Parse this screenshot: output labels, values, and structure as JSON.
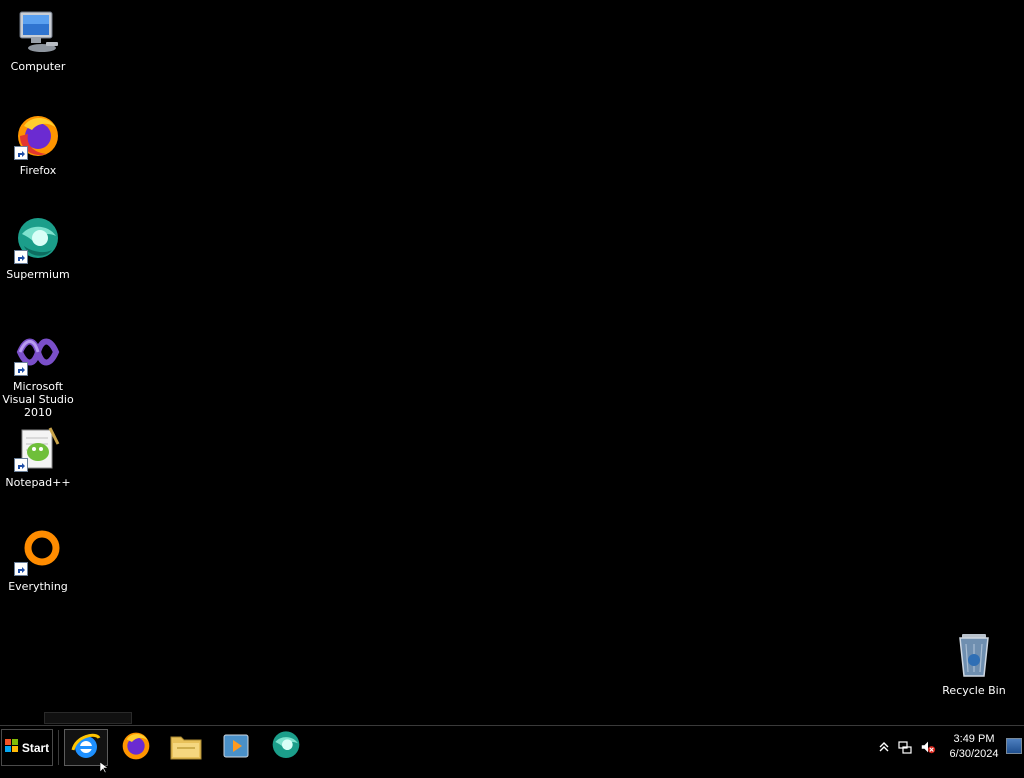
{
  "desktop": {
    "icons": [
      {
        "label": "Computer"
      },
      {
        "label": "Firefox"
      },
      {
        "label": "Supermium"
      },
      {
        "label": "Microsoft Visual Studio 2010"
      },
      {
        "label": "Notepad++"
      },
      {
        "label": "Everything"
      },
      {
        "label": "Recycle Bin"
      }
    ]
  },
  "taskbar": {
    "start_label": "Start",
    "pinned": [
      {
        "name": "internet-explorer",
        "icon": "ie-icon"
      },
      {
        "name": "firefox",
        "icon": "firefox-icon"
      },
      {
        "name": "file-explorer",
        "icon": "folder-icon"
      },
      {
        "name": "media-player",
        "icon": "media-player-icon"
      },
      {
        "name": "supermium",
        "icon": "supermium-icon"
      }
    ],
    "tray": {
      "time": "3:49 PM",
      "date": "6/30/2024"
    }
  },
  "colors": {
    "desktop_bg": "#000000",
    "taskbar_bg": "#000000",
    "text": "#ffffff"
  }
}
